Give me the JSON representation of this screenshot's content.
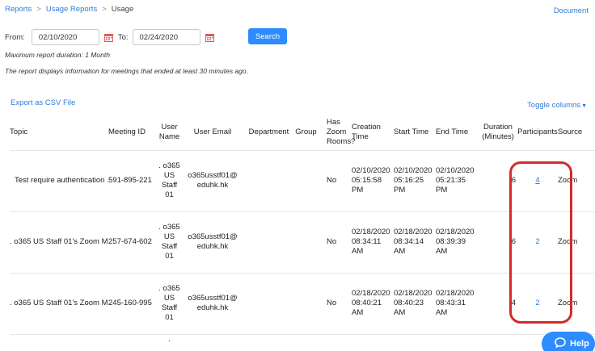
{
  "breadcrumb": {
    "items": [
      "Reports",
      "Usage Reports",
      "Usage"
    ]
  },
  "header": {
    "document_link": "Document"
  },
  "filter": {
    "from_label": "From:",
    "from_value": "02/10/2020",
    "to_label": "To:",
    "to_value": "02/24/2020",
    "search_label": "Search"
  },
  "notes": {
    "max_duration": "Maximum report duration: 1 Month",
    "info": "The report displays information for meetings that ended at least 30 minutes ago."
  },
  "actions": {
    "export_label": "Export as CSV File",
    "toggle_label": "Toggle columns"
  },
  "table": {
    "headers": {
      "topic": "Topic",
      "meeting_id": "Meeting ID",
      "user_name": "User Name",
      "user_email": "User Email",
      "department": "Department",
      "group": "Group",
      "has_zoom_rooms": "Has Zoom Rooms?",
      "creation_time": "Creation Time",
      "start_time": "Start Time",
      "end_time": "End Time",
      "duration": "Duration (Minutes)",
      "participants": "Participants",
      "source": "Source"
    },
    "rows": [
      {
        "topic": "Test require authentication ...",
        "meeting_id": "591-895-221",
        "user_name": ". o365 US Staff 01",
        "user_email": "o365usstf01@eduhk.hk",
        "department": "",
        "group": "",
        "has_zoom_rooms": "No",
        "creation_time": "02/10/2020 05:15:58 PM",
        "start_time": "02/10/2020 05:16:25 PM",
        "end_time": "02/10/2020 05:21:35 PM",
        "duration": "6",
        "participants": "4",
        "source": "Zoom"
      },
      {
        "topic": ". o365 US Staff 01's Zoom M...",
        "meeting_id": "257-674-602",
        "user_name": ". o365 US Staff 01",
        "user_email": "o365usstf01@eduhk.hk",
        "department": "",
        "group": "",
        "has_zoom_rooms": "No",
        "creation_time": "02/18/2020 08:34:11 AM",
        "start_time": "02/18/2020 08:34:14 AM",
        "end_time": "02/18/2020 08:39:39 AM",
        "duration": "6",
        "participants": "2",
        "source": "Zoom"
      },
      {
        "topic": ". o365 US Staff 01's Zoom M...",
        "meeting_id": "245-160-995",
        "user_name": ". o365 US Staff 01",
        "user_email": "o365usstf01@eduhk.hk",
        "department": "",
        "group": "",
        "has_zoom_rooms": "No",
        "creation_time": "02/18/2020 08:40:21 AM",
        "start_time": "02/18/2020 08:40:23 AM",
        "end_time": "02/18/2020 08:43:31 AM",
        "duration": "4",
        "participants": "2",
        "source": "Zoom"
      }
    ],
    "partial_row_user_name": "."
  },
  "help": {
    "label": "Help"
  },
  "colors": {
    "accent": "#2d8cff",
    "link": "#2d7cd9",
    "highlight": "#d42a2a"
  }
}
